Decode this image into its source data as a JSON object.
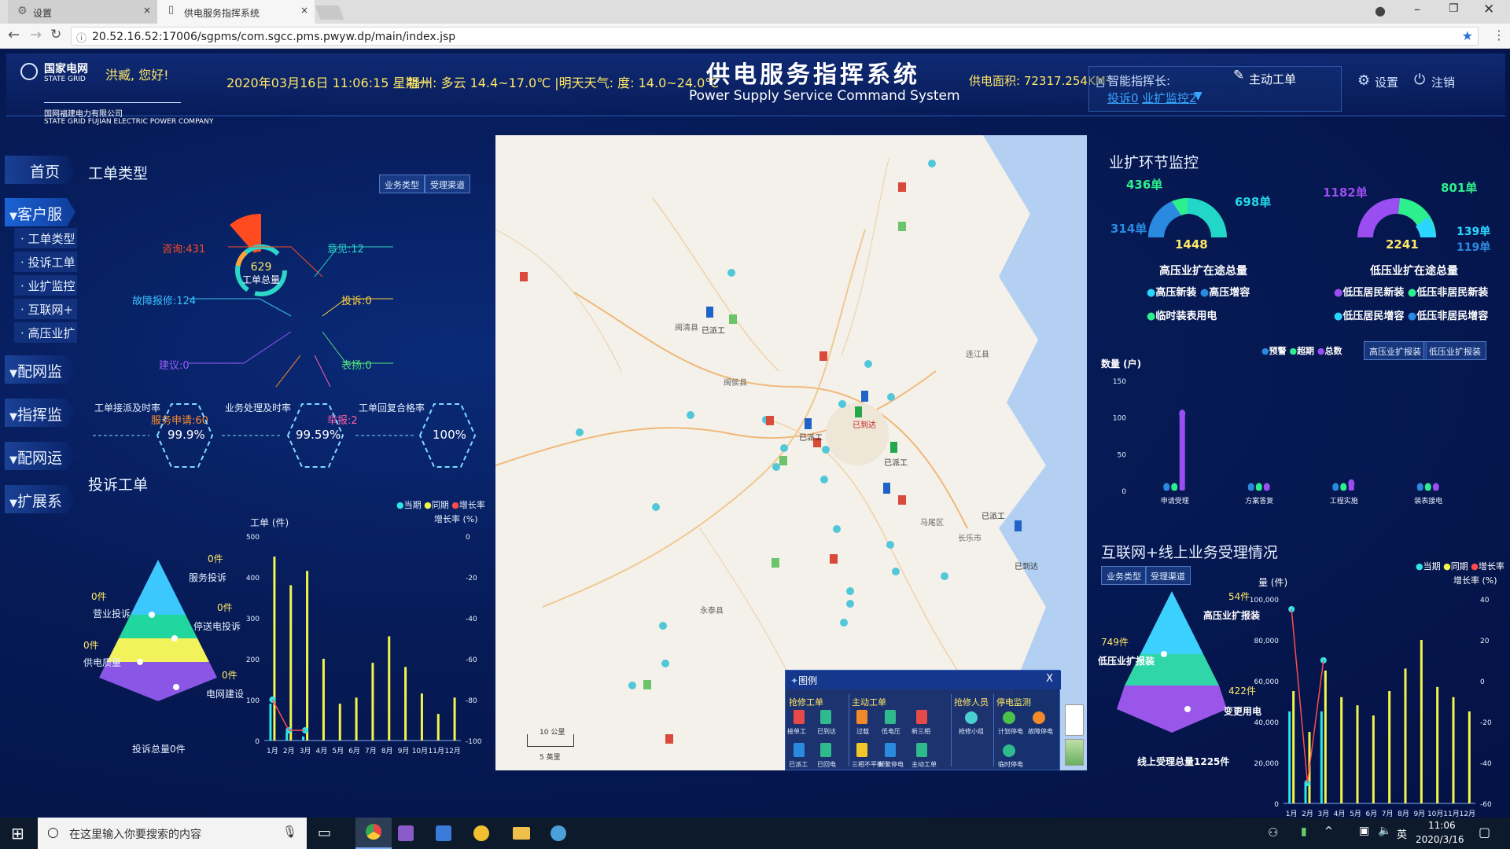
{
  "browser": {
    "tabs": [
      {
        "label": "设置"
      },
      {
        "label": "供电服务指挥系统"
      }
    ],
    "url": "20.52.16.52:17006/sgpms/com.sgcc.pms.pwyw.dp/main/index.jsp"
  },
  "header": {
    "logo_cn": "国家电网",
    "logo_en": "STATE GRID",
    "greeting": "洪臧, 您好!",
    "company_cn": "国网福建电力有限公司",
    "company_en": "STATE GRID FUJIAN ELECTRIC POWER COMPANY",
    "datetime": "2020年03月16日 11:06:15 星期一",
    "weather": "福州: 多云 14.4~17.0℃ |明天天气: 度: 14.0~24.0℃",
    "title_cn": "供电服务指挥系统",
    "title_en": "Power Supply Service Command System",
    "area": "供电面积: 72317.254KM²",
    "director_label": "智能指挥长:",
    "complaint_link": "投诉0",
    "expand_link": "业扩监控2",
    "active_order": "主动工单",
    "settings": "设置",
    "logout": "注销"
  },
  "nav": {
    "home": "首页",
    "customer": "客户服务",
    "subs": [
      "工单类型",
      "投诉工单",
      "业扩监控",
      "互联网+",
      "高压业扩"
    ],
    "distribution_monitor": "配网监测",
    "command_monitor": "指挥监控",
    "distribution_ops": "配网运营",
    "extend": "扩展系统"
  },
  "order_type": {
    "title": "工单类型",
    "btn_business": "业务类型",
    "btn_channel": "受理渠道",
    "center_value": "629",
    "center_label": "工单总量",
    "labels": {
      "consult": "咨询:431",
      "opinion": "意见:12",
      "fault": "故障报修:124",
      "complaint": "投诉:0",
      "suggest": "建议:0",
      "praise": "表扬:0",
      "service": "服务申请:60",
      "report": "举报:2"
    },
    "rates": [
      {
        "label": "工单接派及时率",
        "value": "99.9%"
      },
      {
        "label": "业务处理及时率",
        "value": "99.59%"
      },
      {
        "label": "工单回复合格率",
        "value": "100%"
      }
    ]
  },
  "complaint": {
    "title": "投诉工单",
    "legend": [
      "当期",
      "同期",
      "增长率"
    ],
    "pyramid": [
      {
        "label": "服务投诉",
        "value": "0件"
      },
      {
        "label": "营业投诉",
        "value": "0件"
      },
      {
        "label": "停送电投诉",
        "value": "0件"
      },
      {
        "label": "供电质量",
        "value": "0件"
      },
      {
        "label": "电网建设",
        "value": "0件"
      }
    ],
    "total": "投诉总量0件",
    "ylabel": "工单 (件)",
    "y2label": "增长率 (%)",
    "yticks": [
      "500",
      "400",
      "300",
      "200",
      "100",
      "0"
    ],
    "y2ticks": [
      "0",
      "-20",
      "-40",
      "-60",
      "-80",
      "-100"
    ]
  },
  "expand_monitor": {
    "title": "业扩环节监控",
    "high": {
      "values": [
        "436单",
        "698单",
        "314单",
        "1448"
      ],
      "label": "高压业扩在途总量",
      "legend": [
        "高压新装",
        "高压增容",
        "临时装表用电"
      ]
    },
    "low": {
      "values": [
        "1182单",
        "801单",
        "139单",
        "119单",
        "2241"
      ],
      "label": "低压业扩在途总量",
      "legend": [
        "低压居民新装",
        "低压非居民新装",
        "低压居民增容",
        "低压非居民增容"
      ]
    },
    "legend": [
      "预警",
      "超期",
      "总数"
    ],
    "btn_high": "高压业扩报装",
    "btn_low": "低压业扩报装",
    "ylabel": "数量 (户)",
    "yticks": [
      "150",
      "100",
      "50",
      "0"
    ],
    "stages": [
      "申请受理",
      "方案答复",
      "工程实施",
      "装表接电"
    ]
  },
  "internet": {
    "title": "互联网+线上业务受理情况",
    "btn_business": "业务类型",
    "btn_channel": "受理渠道",
    "pyramid": [
      {
        "label": "高压业扩报装",
        "value": "54件"
      },
      {
        "label": "低压业扩报装",
        "value": "749件"
      },
      {
        "label": "变更用电",
        "value": "422件"
      }
    ],
    "total": "线上受理总量1225件",
    "legend": [
      "当期",
      "同期",
      "增长率"
    ],
    "ylabel": "量 (件)",
    "y2label": "增长率 (%)",
    "yticks": [
      "100,000",
      "80,000",
      "60,000",
      "40,000",
      "20,000",
      "0"
    ],
    "y2ticks": [
      "40",
      "20",
      "0",
      "-20",
      "-40",
      "-60"
    ]
  },
  "months": [
    "1月",
    "2月",
    "3月",
    "4月",
    "5月",
    "6月",
    "7月",
    "8月",
    "9月",
    "10月",
    "11月",
    "12月"
  ],
  "legend_box": {
    "title": "图例",
    "close": "X",
    "groups": [
      {
        "name": "抢修工单",
        "items": [
          "接单工",
          "已到达",
          "已派工",
          "已回电"
        ]
      },
      {
        "name": "主动工单",
        "items": [
          "过载",
          "低电压",
          "新三相",
          "三相不平衡",
          "频繁停电",
          "主动工单"
        ]
      },
      {
        "name": "抢修人员",
        "items": [
          "抢修小组"
        ]
      },
      {
        "name": "停电监测",
        "items": [
          "计划停电",
          "故障停电",
          "临时停电"
        ]
      }
    ],
    "scale_top": "10 公里",
    "scale_bottom": "5 英里"
  },
  "map": {
    "places": [
      "闽清县",
      "已派工",
      "已派工",
      "已到达",
      "已派工",
      "闽侯县",
      "连江县",
      "永泰县",
      "马尾区",
      "长乐市",
      "已派工",
      "已到达"
    ]
  },
  "taskbar": {
    "search_placeholder": "在这里输入你要搜索的内容",
    "time": "11:06",
    "date": "2020/3/16",
    "ime": "英"
  },
  "chart_data": [
    {
      "type": "bar",
      "title": "投诉工单",
      "categories": [
        "1月",
        "2月",
        "3月",
        "4月",
        "5月",
        "6月",
        "7月",
        "8月",
        "9月",
        "10月",
        "11月",
        "12月"
      ],
      "series": [
        {
          "name": "当期",
          "values": [
            90,
            20,
            10,
            0,
            0,
            0,
            0,
            0,
            0,
            0,
            0,
            0
          ]
        },
        {
          "name": "同期",
          "values": [
            450,
            380,
            415,
            200,
            90,
            105,
            190,
            255,
            180,
            115,
            65,
            105
          ]
        },
        {
          "name": "增长率",
          "values": [
            -80,
            -95,
            -95,
            0,
            0,
            0,
            0,
            0,
            0,
            0,
            0,
            0
          ]
        }
      ],
      "ylim": [
        0,
        500
      ],
      "y2lim": [
        -100,
        0
      ]
    },
    {
      "type": "bar",
      "title": "互联网+线上业务受理情况",
      "categories": [
        "1月",
        "2月",
        "3月",
        "4月",
        "5月",
        "6月",
        "7月",
        "8月",
        "9月",
        "10月",
        "11月",
        "12月"
      ],
      "series": [
        {
          "name": "当期",
          "values": [
            45000,
            10000,
            45000,
            0,
            0,
            0,
            0,
            0,
            0,
            0,
            0,
            0
          ]
        },
        {
          "name": "同期",
          "values": [
            55000,
            35000,
            65000,
            52000,
            48000,
            43000,
            55000,
            66000,
            80000,
            57000,
            52000,
            45000
          ]
        },
        {
          "name": "增长率",
          "values": [
            35,
            -50,
            10,
            0,
            0,
            0,
            0,
            0,
            0,
            0,
            0,
            0
          ]
        }
      ],
      "ylim": [
        0,
        100000
      ],
      "y2lim": [
        -60,
        40
      ]
    },
    {
      "type": "bar",
      "title": "业扩环节监控",
      "categories": [
        "申请受理",
        "方案答复",
        "工程实施",
        "装表接电"
      ],
      "series": [
        {
          "name": "预警",
          "values": [
            5,
            5,
            5,
            5
          ]
        },
        {
          "name": "超期",
          "values": [
            5,
            5,
            5,
            5
          ]
        },
        {
          "name": "总数",
          "values": [
            105,
            5,
            10,
            5
          ]
        }
      ],
      "ylim": [
        0,
        150
      ]
    }
  ]
}
